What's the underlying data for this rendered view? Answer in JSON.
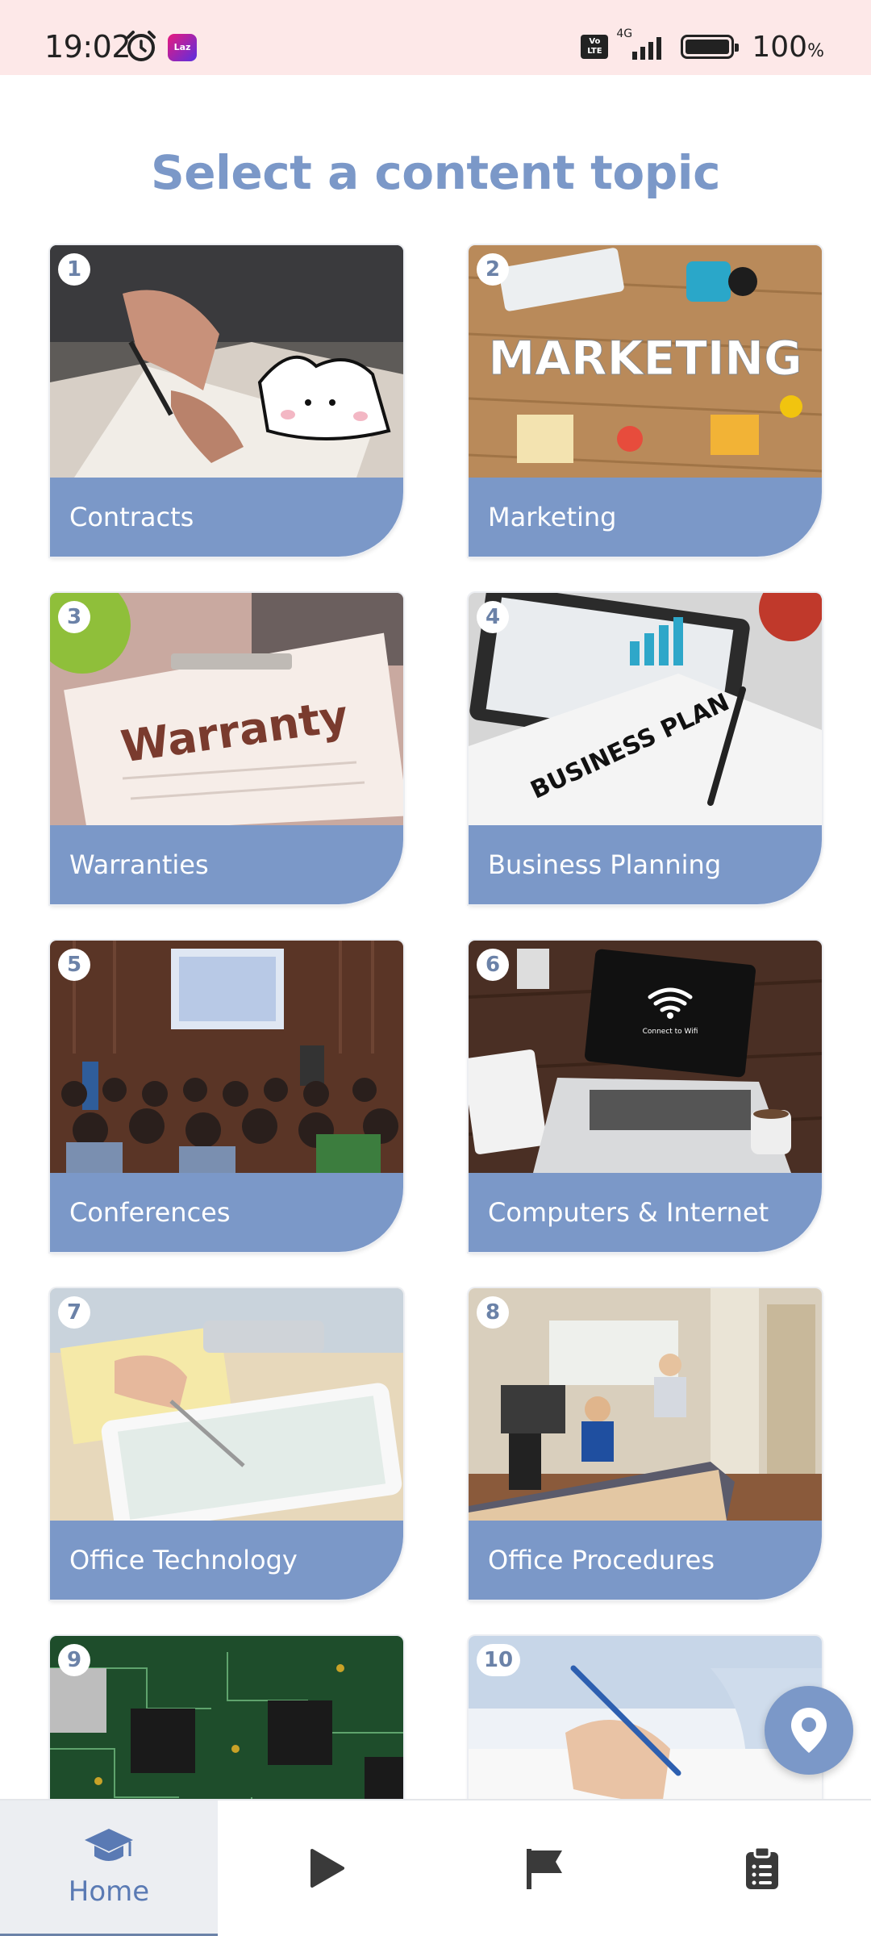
{
  "status_bar": {
    "time": "19:02",
    "app_badge": "Laz",
    "network": "4G",
    "volte": "Vo LTE",
    "battery": "100",
    "battery_unit": "%"
  },
  "page": {
    "title": "Select a content topic"
  },
  "topics": [
    {
      "number": "1",
      "label": "Contracts",
      "image": "contracts-photo"
    },
    {
      "number": "2",
      "label": "Marketing",
      "image": "marketing-photo",
      "image_text": "MARKETING"
    },
    {
      "number": "3",
      "label": "Warranties",
      "image": "warranty-photo",
      "image_text": "Warranty"
    },
    {
      "number": "4",
      "label": "Business Planning",
      "image": "business-plan-photo",
      "image_text": "BUSINESS PLAN"
    },
    {
      "number": "5",
      "label": "Conferences",
      "image": "conference-photo"
    },
    {
      "number": "6",
      "label": "Computers & Internet",
      "image": "laptop-photo",
      "image_text": "Connect to Wifi"
    },
    {
      "number": "7",
      "label": "Office Technology",
      "image": "tablet-photo"
    },
    {
      "number": "8",
      "label": "Office Procedures",
      "image": "office-reception-photo"
    },
    {
      "number": "9",
      "label": "",
      "image": "circuit-board-photo"
    },
    {
      "number": "10",
      "label": "",
      "image": "writing-hand-photo"
    }
  ],
  "fab": {
    "icon": "map-pin-icon"
  },
  "bottom_nav": [
    {
      "label": "Home",
      "icon": "graduation-cap-icon",
      "active": true
    },
    {
      "label": "",
      "icon": "play-icon",
      "active": false
    },
    {
      "label": "",
      "icon": "flag-icon",
      "active": false
    },
    {
      "label": "",
      "icon": "clipboard-icon",
      "active": false
    }
  ],
  "colors": {
    "accent": "#7b98c8",
    "status_bar_bg": "#fde8e8",
    "nav_active_bg": "#eceef2"
  }
}
